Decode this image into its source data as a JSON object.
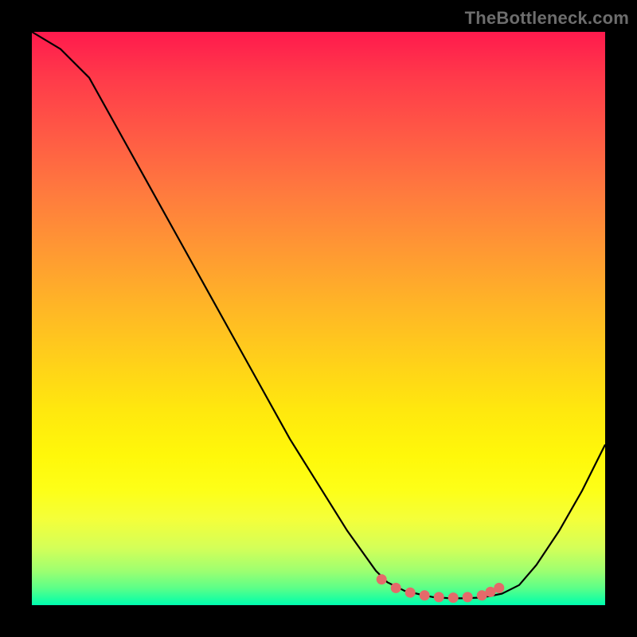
{
  "watermark": "TheBottleneck.com",
  "chart_data": {
    "type": "line",
    "title": "",
    "xlabel": "",
    "ylabel": "",
    "x": [
      0.0,
      0.05,
      0.1,
      0.15,
      0.2,
      0.25,
      0.3,
      0.35,
      0.4,
      0.45,
      0.5,
      0.55,
      0.6,
      0.62,
      0.65,
      0.68,
      0.7,
      0.73,
      0.75,
      0.78,
      0.8,
      0.82,
      0.85,
      0.88,
      0.92,
      0.96,
      1.0
    ],
    "values": [
      1.0,
      0.97,
      0.92,
      0.83,
      0.74,
      0.65,
      0.56,
      0.47,
      0.38,
      0.29,
      0.21,
      0.13,
      0.06,
      0.04,
      0.025,
      0.018,
      0.014,
      0.012,
      0.012,
      0.013,
      0.016,
      0.02,
      0.035,
      0.07,
      0.13,
      0.2,
      0.28
    ],
    "marker_points_x": [
      0.61,
      0.635,
      0.66,
      0.685,
      0.71,
      0.735,
      0.76,
      0.785,
      0.8,
      0.815
    ],
    "marker_points_y": [
      0.045,
      0.03,
      0.022,
      0.017,
      0.014,
      0.013,
      0.014,
      0.017,
      0.023,
      0.03
    ],
    "xlim": [
      0,
      1
    ],
    "ylim": [
      0,
      1
    ],
    "background": "rainbow-vertical-gradient",
    "curve_color": "#000000",
    "marker_color": "#e46a6a"
  }
}
